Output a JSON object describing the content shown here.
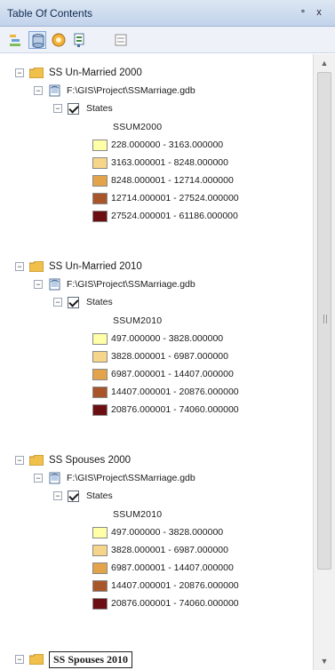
{
  "window": {
    "title": "Table Of Contents",
    "pin": "॰",
    "close": "x"
  },
  "toolbar": {
    "buttons": [
      {
        "icon": "list-by-drawing-order-icon"
      },
      {
        "icon": "list-by-source-icon"
      },
      {
        "icon": "list-by-visibility-icon"
      },
      {
        "icon": "list-by-selection-icon"
      },
      {
        "icon": "options-icon"
      }
    ]
  },
  "groups": [
    {
      "label": "SS Un-Married 2000",
      "source": "F:\\GIS\\Project\\SSMarriage.gdb",
      "layer": "States",
      "field": "SSUM2000",
      "classes": [
        {
          "range": "228.000000 - 3163.000000",
          "color": "#ffffa8"
        },
        {
          "range": "3163.000001 - 8248.000000",
          "color": "#f6d58a"
        },
        {
          "range": "8248.000001 - 12714.000000",
          "color": "#e3a34a"
        },
        {
          "range": "12714.000001 - 27524.000000",
          "color": "#a8552a"
        },
        {
          "range": "27524.000001 - 61186.000000",
          "color": "#6b0f12"
        }
      ]
    },
    {
      "label": "SS Un-Married 2010",
      "source": "F:\\GIS\\Project\\SSMarriage.gdb",
      "layer": "States",
      "field": "SSUM2010",
      "classes": [
        {
          "range": "497.000000 - 3828.000000",
          "color": "#ffffa8"
        },
        {
          "range": "3828.000001 - 6987.000000",
          "color": "#f6d58a"
        },
        {
          "range": "6987.000001 - 14407.000000",
          "color": "#e3a34a"
        },
        {
          "range": "14407.000001 - 20876.000000",
          "color": "#a8552a"
        },
        {
          "range": "20876.000001 - 74060.000000",
          "color": "#6b0f12"
        }
      ]
    },
    {
      "label": "SS Spouses 2000",
      "source": "F:\\GIS\\Project\\SSMarriage.gdb",
      "layer": "States",
      "field": "SSUM2010",
      "classes": [
        {
          "range": "497.000000 - 3828.000000",
          "color": "#ffffa8"
        },
        {
          "range": "3828.000001 - 6987.000000",
          "color": "#f6d58a"
        },
        {
          "range": "6987.000001 - 14407.000000",
          "color": "#e3a34a"
        },
        {
          "range": "14407.000001 - 20876.000000",
          "color": "#a8552a"
        },
        {
          "range": "20876.000001 - 74060.000000",
          "color": "#6b0f12"
        }
      ]
    }
  ],
  "editing_group": {
    "label": "SS Spouses 2010"
  }
}
